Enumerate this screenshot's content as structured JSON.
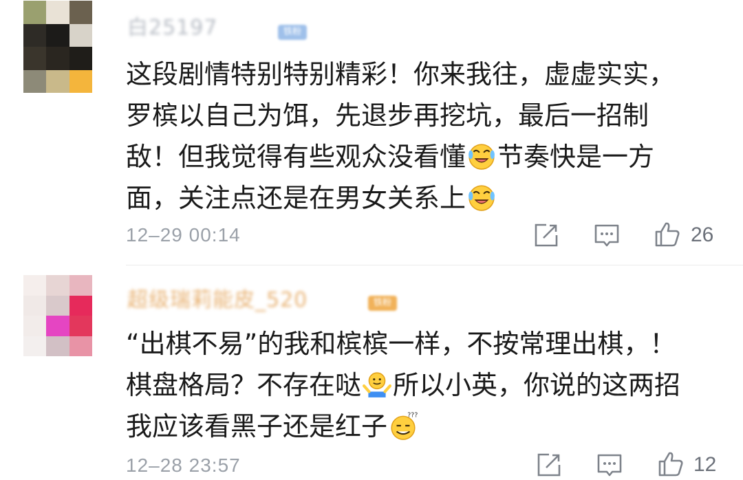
{
  "comments": [
    {
      "username": "白25197",
      "badge": "铁粉",
      "text_lines": [
        "这段剧情特别特别精彩！你来我往，虚虚实实，",
        "罗槟以自己为饵，先退步再挖坑，最后一招制",
        "敌！但我觉得有些观众没看懂",
        "节奏快是一方",
        "面，关注点还是在男女关系上"
      ],
      "timestamp": "12–29 00:14",
      "likes": "26",
      "avatar_colors": [
        "#9aa06f",
        "#e9e2d6",
        "#6b614f",
        "#2e2b26",
        "#1c1b19",
        "#d8d3c9",
        "#3a352c",
        "#2a2620",
        "#1f1d19",
        "#8d8a78",
        "#c9b98a",
        "#f4b53c"
      ]
    },
    {
      "username": "超级瑞莉能皮_520",
      "badge": "铁粉",
      "text_lines": [
        "“出棋不易”的我和槟槟一样，不按常理出棋，！",
        "棋盘格局？不存在哒",
        "所以小英，你说的这两招",
        "我应该看黑子还是红子"
      ],
      "timestamp": "12–28 23:57",
      "likes": "12",
      "avatar_colors": [
        "#f5eeec",
        "#e7d5d4",
        "#e8b6bf",
        "#f0e9e7",
        "#d9c9cb",
        "#e62a5b",
        "#f2ecea",
        "#e545c2",
        "#e3375c",
        "#f3efee",
        "#d2c0c5",
        "#e893a6"
      ]
    }
  ],
  "icons": {
    "share": "share-icon",
    "reply": "comment-icon",
    "like": "thumbs-up-icon",
    "emoji_laugh": "laughing-crying-emoji",
    "emoji_shrug": "shrug-emoji",
    "emoji_confused": "confused-smile-emoji"
  }
}
